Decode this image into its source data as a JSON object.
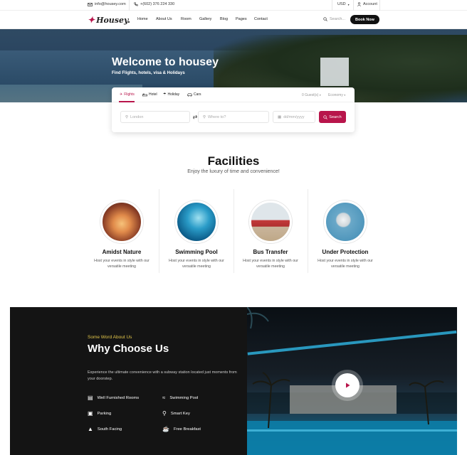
{
  "topbar": {
    "email": "info@housey.com",
    "phone": "+(602) 376 224 330",
    "currency": "USD",
    "account": "Account"
  },
  "nav": {
    "logo": "Housey.",
    "menu": [
      "Home",
      "About Us",
      "Room",
      "Gallery",
      "Blog",
      "Pages",
      "Contact"
    ],
    "search_label": "Search...",
    "book_now": "Book Now"
  },
  "hero": {
    "title": "Welcome to housey",
    "subtitle": "Find Flights, hotels, visa & Holidays"
  },
  "search": {
    "tabs": [
      "Flights",
      "Hotel",
      "Holiday",
      "Cars"
    ],
    "active_tab": "Flights",
    "guests": "0 Guest(s)",
    "class": "Economy",
    "from_placeholder": "London",
    "to_placeholder": "Where to?",
    "date_placeholder": "dd/mm/yyyy",
    "search_button": "Search"
  },
  "facilities": {
    "title": "Facilities",
    "subtitle": "Enjoy the luxury of time and convenience!",
    "items": [
      {
        "title": "Amidst Nature",
        "desc": "Host your events in style with our versatile meeting"
      },
      {
        "title": "Swimming Pool",
        "desc": "Host your events in style with our versatile meeting"
      },
      {
        "title": "Bus Transfer",
        "desc": "Host your events in style with our versatile meeting"
      },
      {
        "title": "Under Protection",
        "desc": "Host your events in style with our versatile meeting"
      }
    ]
  },
  "why": {
    "kicker": "Some Word About Us",
    "title": "Why Choose Us",
    "description": "Experience the ultimate convenience with a subway station located just moments from your doorstep.",
    "features": [
      "Well Furnished Rooms",
      "Swimming Pool",
      "Parking",
      "Smart Key",
      "South Facing",
      "Free Breakfast"
    ]
  },
  "colors": {
    "accent": "#b8154b",
    "dark": "#141414",
    "kicker": "#e3c64a"
  }
}
